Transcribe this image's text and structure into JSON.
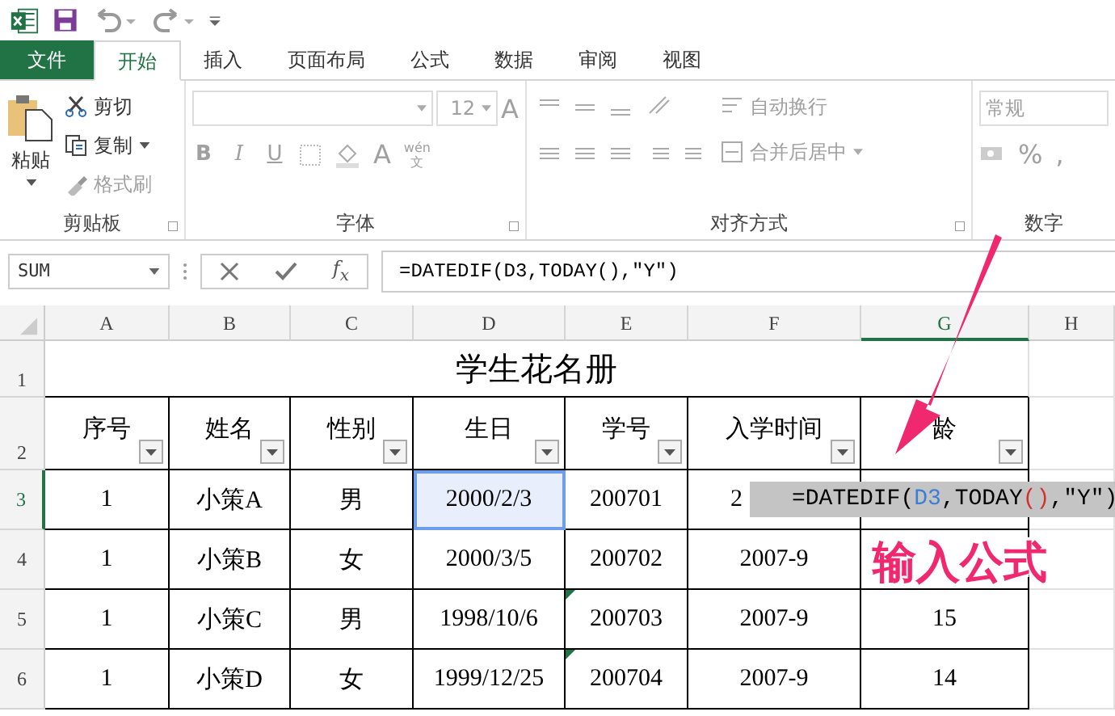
{
  "tabs": [
    {
      "label": "文件",
      "kind": "file",
      "selected": false
    },
    {
      "label": "开始",
      "kind": "tab",
      "selected": true
    },
    {
      "label": "插入",
      "kind": "tab",
      "selected": false
    },
    {
      "label": "页面布局",
      "kind": "tab",
      "selected": false
    },
    {
      "label": "公式",
      "kind": "tab",
      "selected": false
    },
    {
      "label": "数据",
      "kind": "tab",
      "selected": false
    },
    {
      "label": "审阅",
      "kind": "tab",
      "selected": false
    },
    {
      "label": "视图",
      "kind": "tab",
      "selected": false
    }
  ],
  "ribbon": {
    "clipboard": {
      "paste": "粘贴",
      "cut": "剪切",
      "copy": "复制",
      "format_painter": "格式刷",
      "group": "剪贴板"
    },
    "font": {
      "size": "12",
      "bold": "B",
      "italic": "I",
      "underline": "U",
      "grow": "A",
      "font_color": "A",
      "phonetic_top": "wén",
      "phonetic_bottom": "文",
      "group": "字体"
    },
    "alignment": {
      "wrap": "自动换行",
      "merge": "合并后居中",
      "group": "对齐方式"
    },
    "number": {
      "format": "常规",
      "percent": "%",
      "comma": ",",
      "group": "数字"
    }
  },
  "formula_bar": {
    "name_box": "SUM",
    "fx": "f$_{x}$",
    "formula": "=DATEDIF(D3,TODAY(),\"Y\")"
  },
  "sheet": {
    "columns": [
      {
        "label": "A",
        "selected": false
      },
      {
        "label": "B",
        "selected": false
      },
      {
        "label": "C",
        "selected": false
      },
      {
        "label": "D",
        "selected": false
      },
      {
        "label": "E",
        "selected": false
      },
      {
        "label": "F",
        "selected": false
      },
      {
        "label": "G",
        "selected": true
      },
      {
        "label": "H",
        "selected": false
      }
    ],
    "rows": [
      {
        "header": "1",
        "kind": "title",
        "selected": false,
        "title": "学生花名册"
      },
      {
        "header": "2",
        "kind": "head",
        "selected": false,
        "cells": [
          "序号",
          "姓名",
          "性别",
          "生日",
          "学号",
          "入学时间",
          "龄"
        ]
      },
      {
        "header": "3",
        "kind": "data",
        "selected": true,
        "cells": [
          "1",
          "小策A",
          "男",
          {
            "text": "2000/2/3",
            "highlighted": true
          },
          "200701",
          {
            "text": "2",
            "clipped": true
          }
        ]
      },
      {
        "header": "4",
        "kind": "data",
        "selected": false,
        "cells": [
          "1",
          "小策B",
          "女",
          "2000/3/5",
          "200702",
          "2007-9"
        ]
      },
      {
        "header": "5",
        "kind": "data",
        "selected": false,
        "cells": [
          "1",
          "小策C",
          "男",
          "1998/10/6",
          {
            "text": "200703",
            "flag": true
          },
          "2007-9",
          "15"
        ]
      },
      {
        "header": "6",
        "kind": "data",
        "selected": false,
        "cells": [
          "1",
          "小策D",
          "女",
          "1999/12/25",
          {
            "text": "200704",
            "flag": true
          },
          "2007-9",
          "14"
        ]
      }
    ]
  },
  "formula_tip": [
    {
      "text": "=DATEDIF(",
      "kind": "plain"
    },
    {
      "text": "D3",
      "kind": "ref"
    },
    {
      "text": ",TODAY",
      "kind": "plain"
    },
    {
      "text": "()",
      "kind": "paren"
    },
    {
      "text": ",\"Y\")",
      "kind": "plain"
    }
  ],
  "annotation": "输入公式"
}
